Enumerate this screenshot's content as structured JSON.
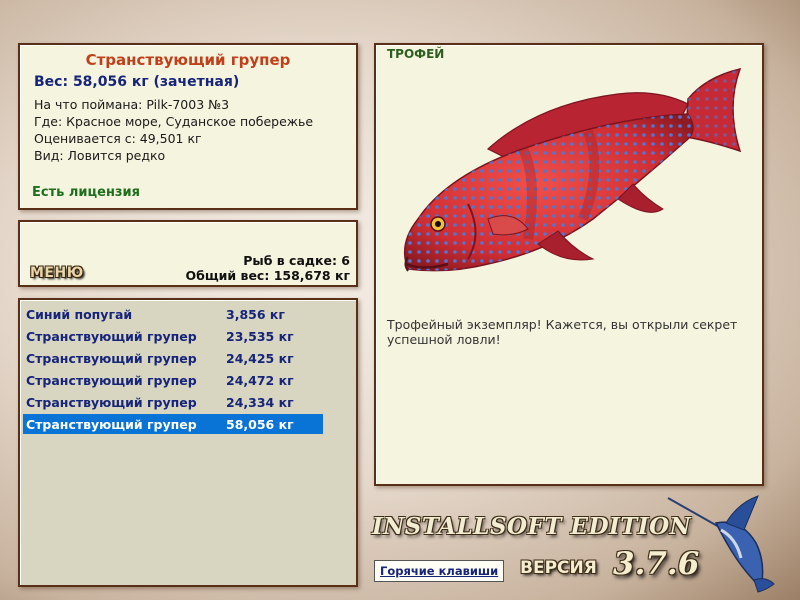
{
  "info": {
    "title": "Странствующий групер",
    "weight": "Вес: 58,056 кг (зачетная)",
    "lines": [
      "На что поймана: Pilk-7003 №3",
      "Где: Красное море, Суданское побережье",
      "Оценивается с: 49,501 кг",
      "Вид: Ловится редко"
    ],
    "license": "Есть лицензия"
  },
  "menu": {
    "label": "МЕНЮ",
    "fish_in_keepnet": "Рыб в садке: 6",
    "total_weight": "Общий вес: 158,678 кг"
  },
  "catch_list": [
    {
      "name": "Синий попугай",
      "weight": "3,856 кг"
    },
    {
      "name": "Странствующий групер",
      "weight": "23,535 кг"
    },
    {
      "name": "Странствующий групер",
      "weight": "24,425 кг"
    },
    {
      "name": "Странствующий групер",
      "weight": "24,472 кг"
    },
    {
      "name": "Странствующий групер",
      "weight": "24,334 кг"
    },
    {
      "name": "Странствующий групер",
      "weight": "58,056 кг",
      "selected": true
    }
  ],
  "trophy": {
    "label": "ТРОФЕЙ",
    "text": "Трофейный экземпляр! Кажется, вы открыли секрет успешной ловли!"
  },
  "footer": {
    "edition": "INSTALLSOFT EDITION",
    "hotkeys": "Горячие клавиши",
    "version_label": "ВЕРСИЯ",
    "version": "3.7.6"
  },
  "colors": {
    "selected_row": "#0a74d6",
    "title": "#c0401a",
    "link": "#16247a",
    "license": "#1d6e1d",
    "fish_body": "#d9333a",
    "fish_spots": "#4c78d8"
  },
  "icons": [
    "grouper-fish-illustration",
    "marlin-icon"
  ]
}
